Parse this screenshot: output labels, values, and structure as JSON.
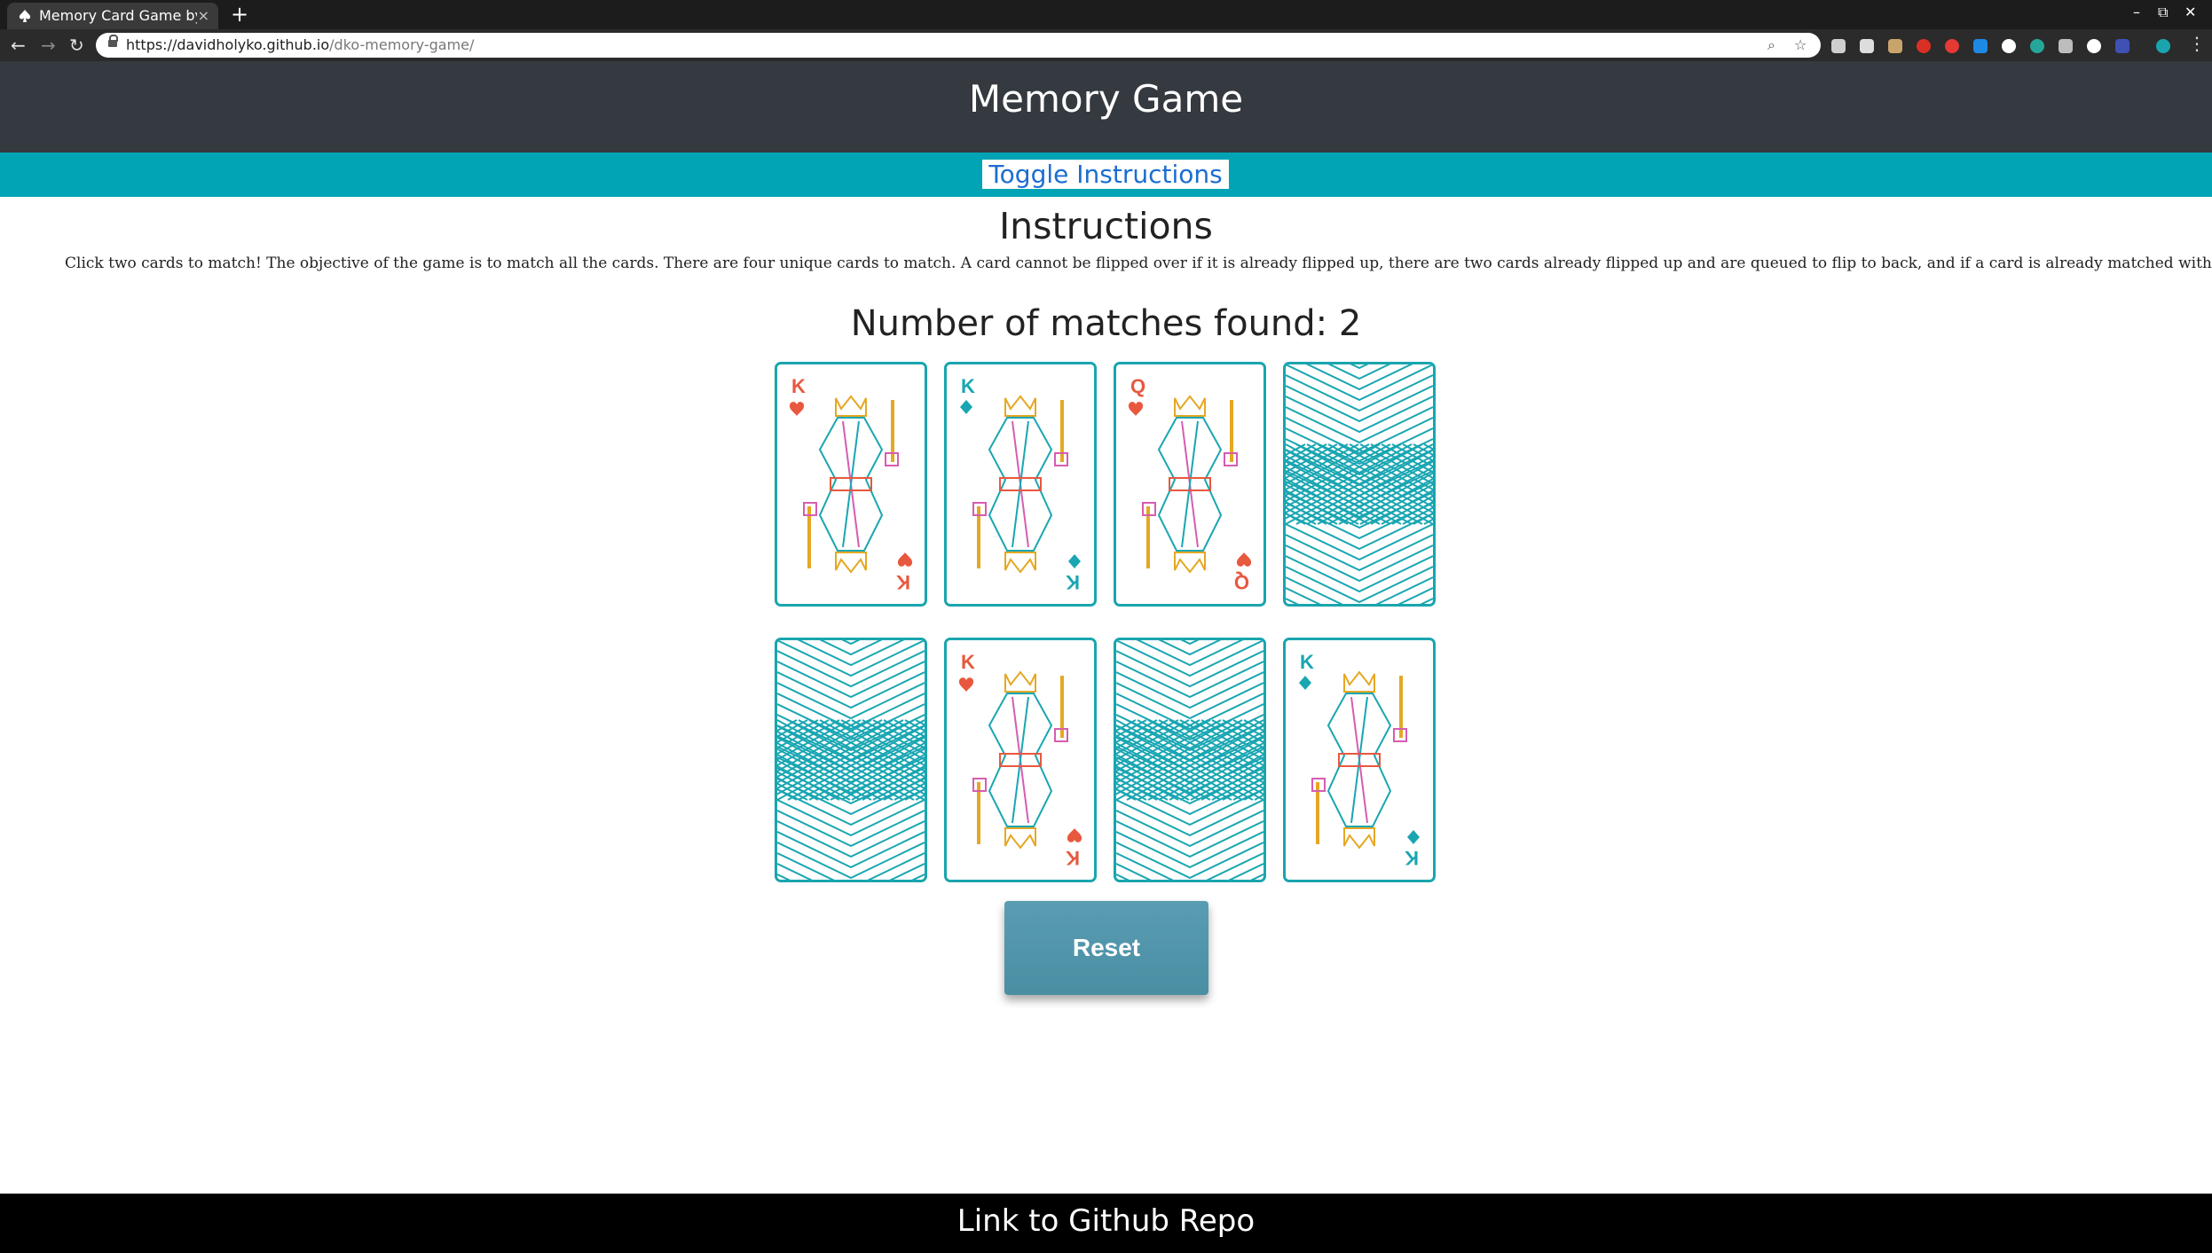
{
  "browser": {
    "tab_title": "Memory Card Game by D",
    "tab_close": "×",
    "new_tab": "+",
    "url_host": "https://davidholyko.github.io",
    "url_path": "/dko-memory-game/"
  },
  "header": {
    "title": "Memory Game"
  },
  "toggle": {
    "label": "Toggle Instructions"
  },
  "instructions": {
    "title": "Instructions",
    "text": "Click two cards to match! The objective of the game is to match all the cards. There are four unique cards to match. A card cannot be flipped over if it is already flipped up, there are two cards already flipped up and are queued to flip to back, and if a card is already matched with another card."
  },
  "status": {
    "matches_label": "Number of matches found: 2",
    "matches_found": 2
  },
  "cards": [
    {
      "state": "face-up",
      "rank": "K",
      "suit": "hearts",
      "color": "#e8583f"
    },
    {
      "state": "face-up",
      "rank": "K",
      "suit": "diamonds",
      "color": "#19a6b2"
    },
    {
      "state": "face-up",
      "rank": "Q",
      "suit": "hearts",
      "color": "#e8583f"
    },
    {
      "state": "face-down"
    },
    {
      "state": "face-down"
    },
    {
      "state": "face-up",
      "rank": "K",
      "suit": "hearts",
      "color": "#e8583f"
    },
    {
      "state": "face-down"
    },
    {
      "state": "face-up",
      "rank": "K",
      "suit": "diamonds",
      "color": "#19a6b2"
    }
  ],
  "reset": {
    "label": "Reset"
  },
  "footer": {
    "link": "Link to Github Repo"
  },
  "colors": {
    "header_bg": "#353940",
    "accent": "#00a4b4",
    "card_border": "#1aa5ae",
    "reset_bg": "#5a9db3"
  }
}
